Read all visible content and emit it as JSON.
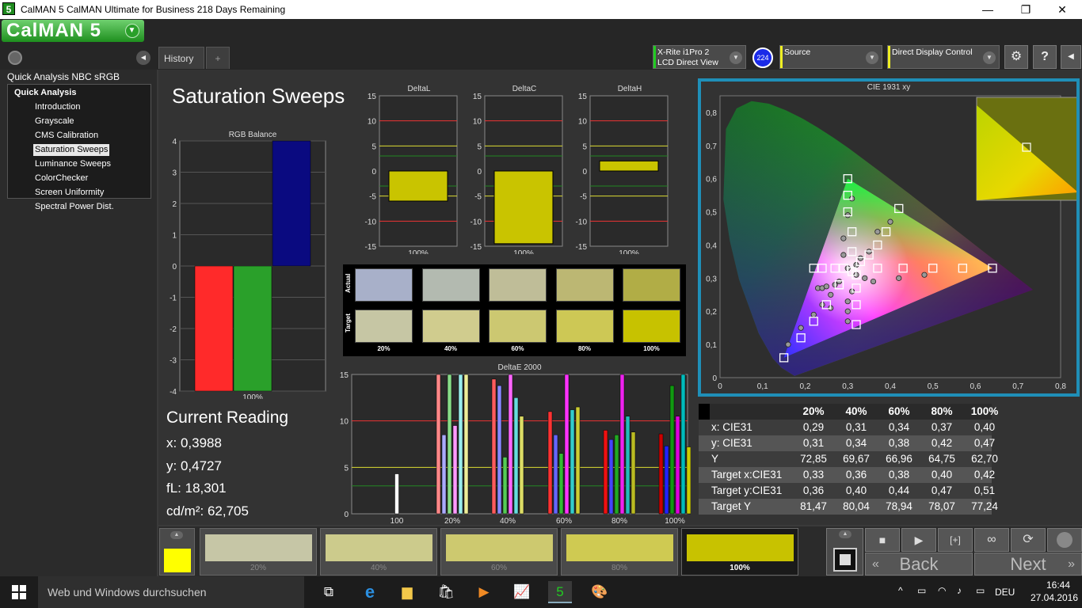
{
  "window": {
    "title": "CalMAN 5 CalMAN Ultimate for Business 218 Days Remaining",
    "app_icon": "5",
    "minimize": "—",
    "maximize": "❐",
    "close": "✕"
  },
  "app": {
    "logo": "CalMAN 5"
  },
  "tabs": {
    "history": "History 1",
    "add": "+"
  },
  "toolbar": {
    "meter_line1": "X-Rite i1Pro 2",
    "meter_line2": "LCD Direct View",
    "meter_badge": "224",
    "source": "Source",
    "display_control": "Direct Display Control"
  },
  "sidebar": {
    "workflow_title": "Quick Analysis NBC sRGB",
    "root": "Quick Analysis",
    "items": [
      "Introduction",
      "Grayscale",
      "CMS Calibration",
      "Saturation Sweeps",
      "Luminance Sweeps",
      "ColorChecker",
      "Screen Uniformity",
      "Spectral Power Dist."
    ],
    "selected_index": 3
  },
  "page": {
    "title": "Saturation Sweeps"
  },
  "current_reading": {
    "heading": "Current Reading",
    "x": "x: 0,3988",
    "y": "y: 0,4727",
    "fL": "fL: 18,301",
    "cdm2": "cd/m²: 62,705"
  },
  "swatches": {
    "actual_label": "Actual",
    "target_label": "Target",
    "labels": [
      "20%",
      "40%",
      "60%",
      "80%",
      "100%"
    ],
    "actual": [
      "#a8b0c9",
      "#b3bab0",
      "#bfbd98",
      "#bcb773",
      "#b1ad46"
    ],
    "target": [
      "#c6c6a4",
      "#d0cc8e",
      "#ccc871",
      "#cdc855",
      "#c7c200"
    ]
  },
  "bottom_swatches": {
    "labels": [
      "20%",
      "40%",
      "60%",
      "80%",
      "100%"
    ],
    "colors": [
      "#c6c6a6",
      "#cccb8c",
      "#cdc96f",
      "#cfca52",
      "#c8c200"
    ],
    "selected_index": 4,
    "current_color": "#ffff00"
  },
  "nav": {
    "back": "Back",
    "next": "Next"
  },
  "table": {
    "headers": [
      "",
      "20%",
      "40%",
      "60%",
      "80%",
      "100%"
    ],
    "rows": [
      {
        "label": "x: CIE31",
        "values": [
          "0,29",
          "0,31",
          "0,34",
          "0,37",
          "0,40"
        ]
      },
      {
        "label": "y: CIE31",
        "values": [
          "0,31",
          "0,34",
          "0,38",
          "0,42",
          "0,47"
        ]
      },
      {
        "label": "Y",
        "values": [
          "72,85",
          "69,67",
          "66,96",
          "64,75",
          "62,70"
        ]
      },
      {
        "label": "Target x:CIE31",
        "values": [
          "0,33",
          "0,36",
          "0,38",
          "0,40",
          "0,42"
        ]
      },
      {
        "label": "Target y:CIE31",
        "values": [
          "0,36",
          "0,40",
          "0,44",
          "0,47",
          "0,51"
        ]
      },
      {
        "label": "Target Y",
        "values": [
          "81,47",
          "80,04",
          "78,94",
          "78,07",
          "77,24"
        ]
      }
    ]
  },
  "taskbar": {
    "search_placeholder": "Web und Windows durchsuchen",
    "lang": "DEU",
    "time": "16:44",
    "date": "27.04.2016"
  },
  "chart_data": [
    {
      "type": "bar",
      "title": "RGB Balance",
      "categories": [
        "100%"
      ],
      "series": [
        {
          "name": "R",
          "values": [
            -4
          ],
          "color": "#ff2a2a"
        },
        {
          "name": "G",
          "values": [
            -4
          ],
          "color": "#2aa02a"
        },
        {
          "name": "B",
          "values": [
            4
          ],
          "color": "#0a0a80"
        }
      ],
      "yticks": [
        4,
        3,
        2,
        1,
        0,
        -1,
        -2,
        -3,
        -4
      ],
      "ylim": [
        -4,
        4
      ]
    },
    {
      "type": "bar",
      "title": "DeltaL",
      "categories": [
        "100%"
      ],
      "values": [
        -6
      ],
      "ylim": [
        -15,
        15
      ],
      "yticks": [
        15,
        10,
        5,
        0,
        -5,
        -10,
        -15
      ]
    },
    {
      "type": "bar",
      "title": "DeltaC",
      "categories": [
        "100%"
      ],
      "values": [
        -14.5
      ],
      "ylim": [
        -15,
        15
      ],
      "yticks": [
        15,
        10,
        5,
        0,
        -5,
        -10,
        -15
      ]
    },
    {
      "type": "bar",
      "title": "DeltaH",
      "categories": [
        "100%"
      ],
      "values": [
        2
      ],
      "ylim": [
        -15,
        15
      ],
      "yticks": [
        15,
        10,
        5,
        0,
        -5,
        -10,
        -15
      ]
    },
    {
      "type": "bar",
      "title": "DeltaE 2000",
      "categories": [
        "100",
        "20%",
        "40%",
        "60%",
        "80%",
        "100%"
      ],
      "ylim": [
        0,
        15
      ],
      "yticks": [
        15,
        10,
        5,
        0
      ],
      "groups": [
        {
          "label": "100",
          "values": [
            4.3
          ],
          "colors": [
            "#ffffff"
          ]
        },
        {
          "label": "20%",
          "values": [
            15,
            8.5,
            15,
            9.5,
            15,
            15
          ],
          "colors": [
            "#ff8888",
            "#aaaaff",
            "#88dd88",
            "#ff99ff",
            "#99eeee",
            "#eeee99"
          ]
        },
        {
          "label": "40%",
          "values": [
            14.5,
            13.8,
            6.1,
            15,
            12.5,
            10.5
          ],
          "colors": [
            "#ff5c5c",
            "#8888ff",
            "#55cc55",
            "#ff66ff",
            "#66dddd",
            "#dddd66"
          ]
        },
        {
          "label": "60%",
          "values": [
            11,
            8.5,
            6.5,
            15,
            11.2,
            11.5
          ],
          "colors": [
            "#ff3333",
            "#6666ff",
            "#33bb33",
            "#ff33ff",
            "#33cccc",
            "#cccc33"
          ]
        },
        {
          "label": "80%",
          "values": [
            9,
            8,
            8.5,
            15,
            10.5,
            8.8
          ],
          "colors": [
            "#ee1111",
            "#4444ff",
            "#22aa22",
            "#ee22ee",
            "#22bbbb",
            "#bbbb22"
          ]
        },
        {
          "label": "100%",
          "values": [
            8.6,
            7.3,
            13.8,
            10.5,
            15,
            7.2
          ],
          "colors": [
            "#cc0000",
            "#2222ff",
            "#119911",
            "#dd00dd",
            "#00bbbb",
            "#cccc00"
          ]
        }
      ]
    },
    {
      "type": "scatter",
      "title": "CIE 1931 xy",
      "xlim": [
        0,
        0.8
      ],
      "ylim": [
        0,
        0.85
      ],
      "xticks": [
        "0",
        "0,1",
        "0,2",
        "0,3",
        "0,4",
        "0,5",
        "0,6",
        "0,7",
        "0,8"
      ],
      "yticks": [
        "0",
        "0,1",
        "0,2",
        "0,3",
        "0,4",
        "0,5",
        "0,6",
        "0,7",
        "0,8"
      ],
      "gamut": {
        "red": [
          0.64,
          0.33
        ],
        "green": [
          0.3,
          0.6
        ],
        "blue": [
          0.15,
          0.06
        ]
      },
      "white": [
        0.3127,
        0.329
      ],
      "targets": [
        [
          0.15,
          0.06
        ],
        [
          0.19,
          0.12
        ],
        [
          0.22,
          0.17
        ],
        [
          0.25,
          0.22
        ],
        [
          0.28,
          0.28
        ],
        [
          0.3,
          0.6
        ],
        [
          0.3,
          0.55
        ],
        [
          0.3,
          0.5
        ],
        [
          0.31,
          0.44
        ],
        [
          0.31,
          0.38
        ],
        [
          0.64,
          0.33
        ],
        [
          0.57,
          0.33
        ],
        [
          0.5,
          0.33
        ],
        [
          0.43,
          0.33
        ],
        [
          0.37,
          0.33
        ],
        [
          0.32,
          0.16
        ],
        [
          0.32,
          0.22
        ],
        [
          0.32,
          0.27
        ],
        [
          0.32,
          0.31
        ],
        [
          0.22,
          0.33
        ],
        [
          0.24,
          0.33
        ],
        [
          0.27,
          0.33
        ],
        [
          0.29,
          0.33
        ],
        [
          0.42,
          0.51
        ],
        [
          0.39,
          0.44
        ],
        [
          0.37,
          0.4
        ],
        [
          0.35,
          0.37
        ],
        [
          0.33,
          0.35
        ],
        [
          0.28,
          0.28
        ],
        [
          0.31,
          0.32
        ]
      ],
      "measured": [
        [
          0.16,
          0.1
        ],
        [
          0.19,
          0.15
        ],
        [
          0.22,
          0.19
        ],
        [
          0.24,
          0.22
        ],
        [
          0.26,
          0.25
        ],
        [
          0.31,
          0.54
        ],
        [
          0.3,
          0.49
        ],
        [
          0.29,
          0.42
        ],
        [
          0.29,
          0.37
        ],
        [
          0.3,
          0.33
        ],
        [
          0.48,
          0.31
        ],
        [
          0.42,
          0.3
        ],
        [
          0.36,
          0.29
        ],
        [
          0.34,
          0.3
        ],
        [
          0.32,
          0.31
        ],
        [
          0.3,
          0.17
        ],
        [
          0.3,
          0.2
        ],
        [
          0.3,
          0.23
        ],
        [
          0.31,
          0.26
        ],
        [
          0.23,
          0.27
        ],
        [
          0.24,
          0.27
        ],
        [
          0.25,
          0.275
        ],
        [
          0.27,
          0.28
        ],
        [
          0.4,
          0.47
        ],
        [
          0.37,
          0.44
        ],
        [
          0.35,
          0.38
        ],
        [
          0.33,
          0.36
        ],
        [
          0.32,
          0.34
        ],
        [
          0.26,
          0.21
        ],
        [
          0.28,
          0.29
        ]
      ]
    }
  ]
}
